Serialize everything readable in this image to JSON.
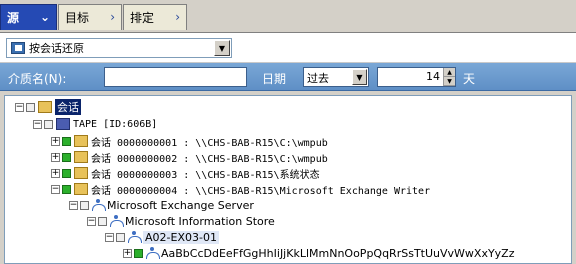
{
  "tabs": [
    {
      "label": "源"
    },
    {
      "label": "目标"
    },
    {
      "label": "排定"
    }
  ],
  "restore_method": "按会话还原",
  "filter": {
    "media_name_label": "介质名(N):",
    "media_name_value": "",
    "date_label": "日期",
    "date_mode": "过去",
    "days_value": "14",
    "days_unit": "天"
  },
  "tree": {
    "root": "会话",
    "tape": "TAPE [ID:606B]",
    "sessions": [
      {
        "label": "会话 0000000001 : \\\\CHS-BAB-R15\\C:\\wmpub"
      },
      {
        "label": "会话 0000000002 : \\\\CHS-BAB-R15\\C:\\wmpub"
      },
      {
        "label": "会话 0000000003 : \\\\CHS-BAB-R15\\系统状态"
      },
      {
        "label": "会话 0000000004 : \\\\CHS-BAB-R15\\Microsoft Exchange Writer"
      }
    ],
    "exchange_server": "Microsoft Exchange Server",
    "info_store": "Microsoft Information Store",
    "server_node": "A02-EX03-01",
    "mailbox": "AaBbCcDdEeFfGgHhIiJjKkLlMmNnOoPpQqRrSsTtUuVvWwXxYyZz"
  }
}
